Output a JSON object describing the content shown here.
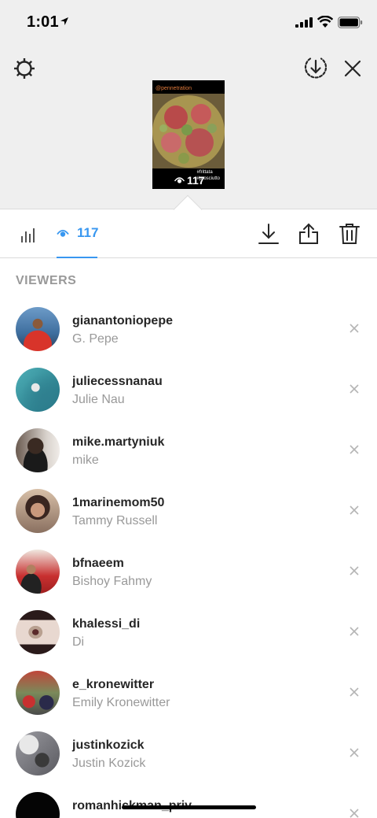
{
  "status_bar": {
    "time": "1:01"
  },
  "story": {
    "thumbnail_username": "@pennetration",
    "thumbnail_tags": [
      "#frittata",
      "#prosciutto"
    ],
    "view_count": "117"
  },
  "tabs": {
    "viewers_count": "117"
  },
  "viewers_header": "VIEWERS",
  "viewers": [
    {
      "username": "gianantoniopepe",
      "full_name": "G. Pepe"
    },
    {
      "username": "juliecessnanau",
      "full_name": "Julie Nau"
    },
    {
      "username": "mike.martyniuk",
      "full_name": "mike"
    },
    {
      "username": "1marinemom50",
      "full_name": "Tammy Russell"
    },
    {
      "username": "bfnaeem",
      "full_name": "Bishoy Fahmy"
    },
    {
      "username": "khalessi_di",
      "full_name": "Di"
    },
    {
      "username": "e_kronewitter",
      "full_name": "Emily Kronewitter"
    },
    {
      "username": "justinkozick",
      "full_name": "Justin Kozick"
    },
    {
      "username": "romanhickman_priv",
      "full_name": ""
    }
  ],
  "colors": {
    "accent": "#3897f0",
    "secondary_text": "#999999",
    "primary_text": "#262626",
    "top_bg": "#efefef"
  },
  "icons": [
    "location-arrow-icon",
    "signal-icon",
    "wifi-icon",
    "battery-icon",
    "gear-icon",
    "save-story-icon",
    "close-icon",
    "insights-icon",
    "eye-icon",
    "download-icon",
    "share-icon",
    "trash-icon",
    "remove-viewer-icon"
  ]
}
